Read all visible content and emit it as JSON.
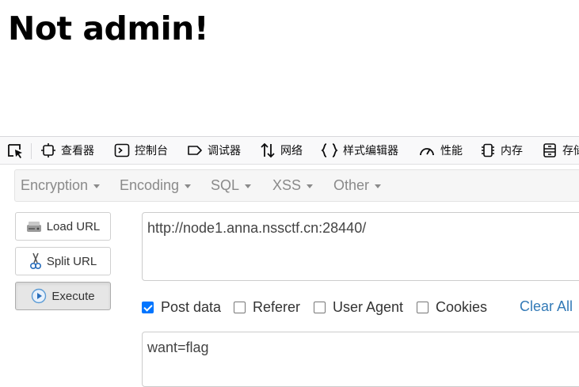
{
  "page": {
    "heading": "Not admin!"
  },
  "devtools": {
    "tabs": [
      {
        "label": "查看器",
        "icon": "inspector-icon"
      },
      {
        "label": "控制台",
        "icon": "console-icon"
      },
      {
        "label": "调试器",
        "icon": "debugger-icon"
      },
      {
        "label": "网络",
        "icon": "network-icon"
      },
      {
        "label": "样式编辑器",
        "icon": "style-editor-icon"
      },
      {
        "label": "性能",
        "icon": "performance-icon"
      },
      {
        "label": "内存",
        "icon": "memory-icon"
      },
      {
        "label": "存储",
        "icon": "storage-icon"
      }
    ]
  },
  "hackbar": {
    "menu": [
      "Encryption",
      "Encoding",
      "SQL",
      "XSS",
      "Other"
    ],
    "buttons": {
      "load": "Load URL",
      "split": "Split URL",
      "execute": "Execute"
    },
    "url_value": "http://node1.anna.nssctf.cn:28440/",
    "options": {
      "post_data": {
        "label": "Post data",
        "checked": true
      },
      "referer": {
        "label": "Referer",
        "checked": false
      },
      "user_agent": {
        "label": "User Agent",
        "checked": false
      },
      "cookies": {
        "label": "Cookies",
        "checked": false
      }
    },
    "clear_all": "Clear All",
    "post_value": "want=flag"
  }
}
